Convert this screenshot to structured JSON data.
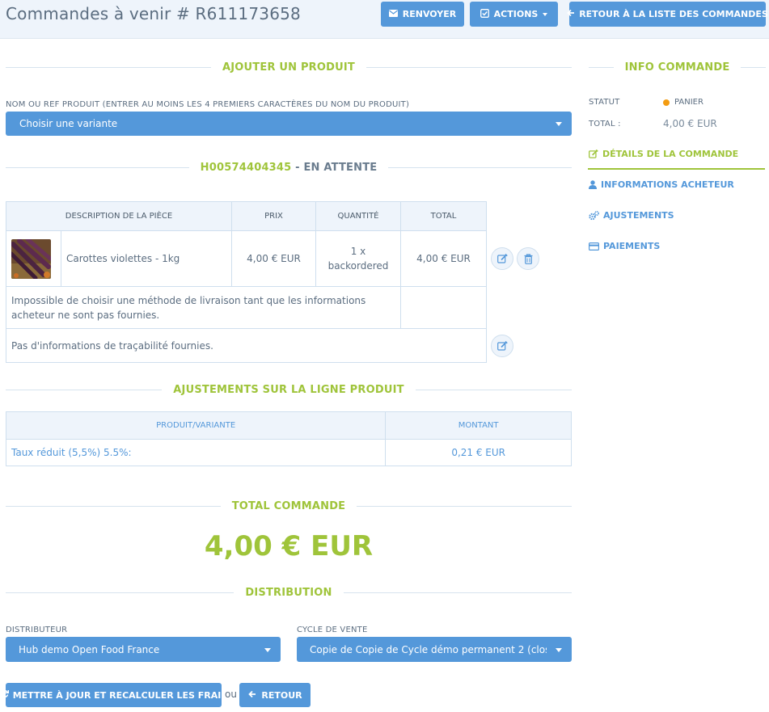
{
  "header": {
    "title": "Commandes à venir # R611173658",
    "resend_label": "RENVOYER",
    "actions_label": "ACTIONS",
    "back_list_label": "RETOUR À LA LISTE DES COMMANDES"
  },
  "add_product": {
    "heading": "AJOUTER UN PRODUIT",
    "field_label": "NOM OU REF PRODUIT (ENTRER AU MOINS LES 4 PREMIERS CARACTÈRES DU NOM DU PRODUIT)",
    "select_value": "Choisir une variante"
  },
  "shipment": {
    "number": "H00574404345",
    "state": "- EN ATTENTE",
    "columns": [
      "DESCRIPTION DE LA PIÈCE",
      "PRIX",
      "QUANTITÉ",
      "TOTAL"
    ],
    "item": {
      "name": "Carottes violettes - 1kg",
      "price": "4,00 € EUR",
      "quantity_line1": "1 x",
      "quantity_line2": "backordered",
      "total": "4,00 € EUR"
    },
    "shipping_notice": "Impossible de choisir une méthode de livraison tant que les informations acheteur ne sont pas fournies.",
    "tracking_notice": "Pas d'informations de traçabilité fournies."
  },
  "adjustments": {
    "heading": "AJUSTEMENTS SUR LA LIGNE PRODUIT",
    "columns": [
      "PRODUIT/VARIANTE",
      "MONTANT"
    ],
    "rows": [
      {
        "label": "Taux réduit (5,5%) 5.5%:",
        "amount": "0,21 € EUR"
      }
    ]
  },
  "total": {
    "heading": "TOTAL COMMANDE",
    "amount": "4,00 € EUR"
  },
  "distribution": {
    "heading": "DISTRIBUTION",
    "distributor_label": "DISTRIBUTEUR",
    "distributor_value": "Hub demo Open Food France",
    "cycle_label": "CYCLE DE VENTE",
    "cycle_value": "Copie de Copie de Cycle démo permanent 2 (clos..."
  },
  "footer": {
    "update_label": "METTRE À JOUR ET RECALCULER LES FRAIS",
    "or_text": "ou",
    "back_label": "RETOUR"
  },
  "sidebar": {
    "heading": "INFO COMMANDE",
    "status_label": "STATUT",
    "status_value": "PANIER",
    "total_label": "TOTAL :",
    "total_value": "4,00 € EUR",
    "items": [
      {
        "label": "DÉTAILS DE LA COMMANDE",
        "icon": "edit-icon"
      },
      {
        "label": "INFORMATIONS ACHETEUR",
        "icon": "user-icon"
      },
      {
        "label": "AJUSTEMENTS",
        "icon": "cogs-icon"
      },
      {
        "label": "PAIEMENTS",
        "icon": "credit-card-icon"
      }
    ]
  },
  "colors": {
    "accent": "#5498da",
    "highlight": "#9fc43a",
    "status_dot": "#f39c12"
  }
}
